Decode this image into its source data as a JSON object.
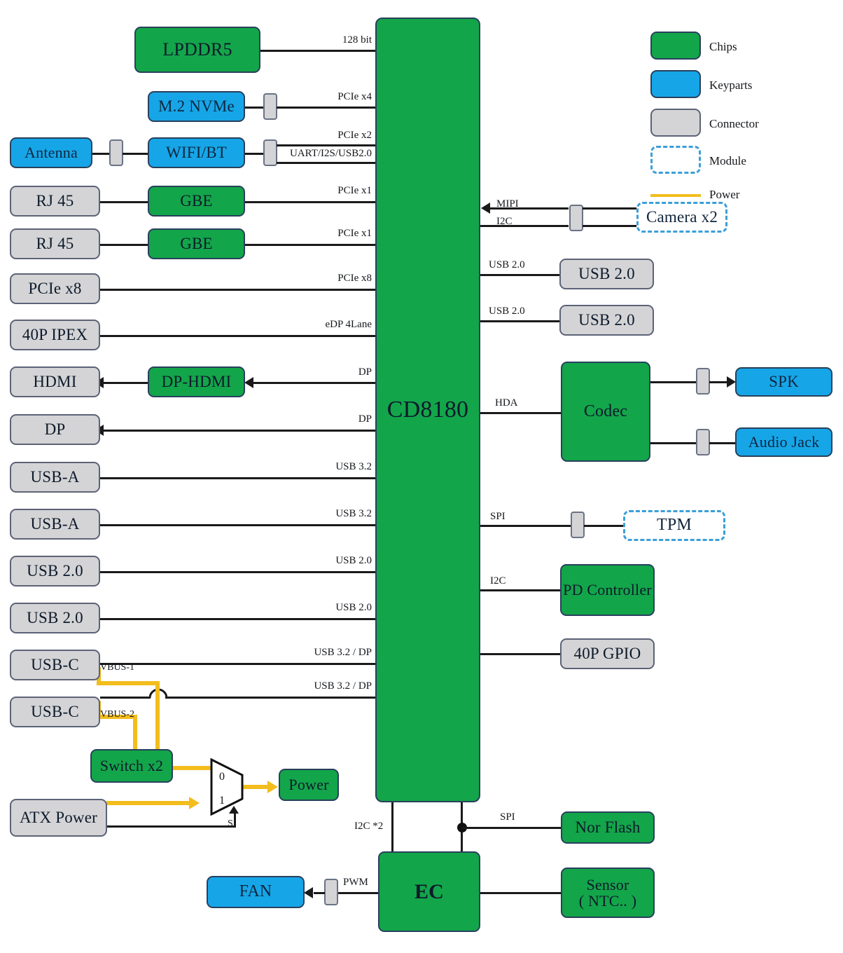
{
  "diagram": {
    "soc": {
      "label": "CD8180"
    },
    "legend": [
      {
        "label": "Chips",
        "kind": "chip",
        "color": "#13a54a"
      },
      {
        "label": "Keyparts",
        "kind": "keypart",
        "color": "#16a6e8"
      },
      {
        "label": "Connector",
        "kind": "connector",
        "color": "#d4d4d6"
      },
      {
        "label": "Module",
        "kind": "module",
        "color": "#3a9fd8"
      },
      {
        "label": "Power",
        "kind": "power",
        "color": "#f2bd1d"
      }
    ],
    "left_nodes": [
      {
        "id": "lpddr5",
        "label": "LPDDR5",
        "kind": "chip"
      },
      {
        "id": "m2nvme",
        "label": "M.2 NVMe",
        "kind": "keypart"
      },
      {
        "id": "antenna",
        "label": "Antenna",
        "kind": "keypart"
      },
      {
        "id": "wifibt",
        "label": "WIFI/BT",
        "kind": "keypart"
      },
      {
        "id": "rj45a",
        "label": "RJ 45",
        "kind": "connector"
      },
      {
        "id": "gbea",
        "label": "GBE",
        "kind": "chip"
      },
      {
        "id": "rj45b",
        "label": "RJ 45",
        "kind": "connector"
      },
      {
        "id": "gbeb",
        "label": "GBE",
        "kind": "chip"
      },
      {
        "id": "pciex8",
        "label": "PCIe x8",
        "kind": "connector"
      },
      {
        "id": "ipex",
        "label": "40P IPEX",
        "kind": "connector"
      },
      {
        "id": "hdmi",
        "label": "HDMI",
        "kind": "connector"
      },
      {
        "id": "dphdmi",
        "label": "DP-HDMI",
        "kind": "chip"
      },
      {
        "id": "dp",
        "label": "DP",
        "kind": "connector"
      },
      {
        "id": "usba1",
        "label": "USB-A",
        "kind": "connector"
      },
      {
        "id": "usba2",
        "label": "USB-A",
        "kind": "connector"
      },
      {
        "id": "usb20a",
        "label": "USB 2.0",
        "kind": "connector"
      },
      {
        "id": "usb20b",
        "label": "USB 2.0",
        "kind": "connector"
      },
      {
        "id": "usbc1",
        "label": "USB-C",
        "kind": "connector"
      },
      {
        "id": "usbc2",
        "label": "USB-C",
        "kind": "connector"
      },
      {
        "id": "switchx2",
        "label": "Switch x2",
        "kind": "chip"
      },
      {
        "id": "atx",
        "label": "ATX Power",
        "kind": "connector"
      },
      {
        "id": "power",
        "label": "Power",
        "kind": "chip"
      }
    ],
    "right_nodes": [
      {
        "id": "camera",
        "label": "Camera x2",
        "kind": "module"
      },
      {
        "id": "rusb20a",
        "label": "USB 2.0",
        "kind": "connector"
      },
      {
        "id": "rusb20b",
        "label": "USB 2.0",
        "kind": "connector"
      },
      {
        "id": "codec",
        "label": "Codec",
        "kind": "chip"
      },
      {
        "id": "spk",
        "label": "SPK",
        "kind": "keypart"
      },
      {
        "id": "ajack",
        "label": "Audio Jack",
        "kind": "keypart"
      },
      {
        "id": "tpm",
        "label": "TPM",
        "kind": "module"
      },
      {
        "id": "pdctrl",
        "label": "PD Controller",
        "kind": "chip"
      },
      {
        "id": "gpio",
        "label": "40P GPIO",
        "kind": "connector"
      },
      {
        "id": "norflash",
        "label": "Nor Flash",
        "kind": "chip"
      },
      {
        "id": "ec",
        "label": "EC",
        "kind": "chip"
      },
      {
        "id": "sensor",
        "label": "Sensor\n( NTC.. )",
        "kind": "chip"
      },
      {
        "id": "fan",
        "label": "FAN",
        "kind": "keypart"
      }
    ],
    "bus_labels_left": [
      {
        "id": "b_128bit",
        "text": "128 bit"
      },
      {
        "id": "b_pcie4",
        "text": "PCIe x4"
      },
      {
        "id": "b_pcie2",
        "text": "PCIe x2"
      },
      {
        "id": "b_uart",
        "text": "UART/I2S/USB2.0"
      },
      {
        "id": "b_pcie1a",
        "text": "PCIe x1"
      },
      {
        "id": "b_pcie1b",
        "text": "PCIe x1"
      },
      {
        "id": "b_pcie8",
        "text": "PCIe x8"
      },
      {
        "id": "b_edp",
        "text": "eDP 4Lane"
      },
      {
        "id": "b_dp1",
        "text": "DP"
      },
      {
        "id": "b_dp2",
        "text": "DP"
      },
      {
        "id": "b_usb32a",
        "text": "USB 3.2"
      },
      {
        "id": "b_usb32b",
        "text": "USB 3.2"
      },
      {
        "id": "b_usb20a",
        "text": "USB 2.0"
      },
      {
        "id": "b_usb20b",
        "text": "USB 2.0"
      },
      {
        "id": "b_usbcdp1",
        "text": "USB 3.2 / DP"
      },
      {
        "id": "b_usbcdp2",
        "text": "USB 3.2 / DP"
      }
    ],
    "bus_labels_right": [
      {
        "id": "b_mipi",
        "text": "MIPI"
      },
      {
        "id": "b_i2c_c",
        "text": "I2C"
      },
      {
        "id": "b_ru20a",
        "text": "USB 2.0"
      },
      {
        "id": "b_ru20b",
        "text": "USB 2.0"
      },
      {
        "id": "b_hda",
        "text": "HDA"
      },
      {
        "id": "b_spi",
        "text": "SPI"
      },
      {
        "id": "b_i2c_p",
        "text": "I2C"
      }
    ],
    "bus_labels_bottom": [
      {
        "id": "b_i2c2",
        "text": "I2C *2"
      },
      {
        "id": "b_spi_nor",
        "text": "SPI"
      },
      {
        "id": "b_pwm",
        "text": "PWM"
      }
    ],
    "power_labels": [
      {
        "id": "vbus1",
        "text": "VBUS-1"
      },
      {
        "id": "vbus2",
        "text": "VBUS-2"
      }
    ],
    "mux": {
      "in0": "0",
      "in1": "1",
      "sel": "S"
    }
  }
}
